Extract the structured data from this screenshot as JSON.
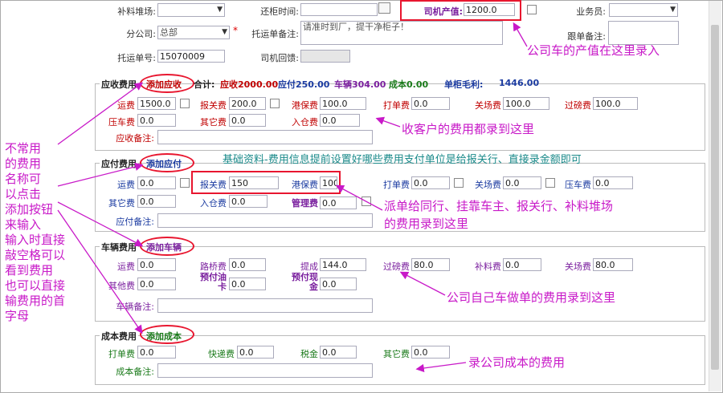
{
  "top": {
    "bu_liao_dui_chang_label": "补料堆场:",
    "huan_gui_shi_jian_label": "还柜时间:",
    "siji_chanzhi_label": "司机产值:",
    "siji_chanzhi_value": "1200.0",
    "ye_wu_yuan_label": "业务员:",
    "fen_gong_si_label": "分公司:",
    "fen_gong_si_value": "总部",
    "required_mark": "*",
    "tuo_yun_dan_bei_zhu_label": "托运单备注:",
    "tuo_yun_dan_bei_zhu_value": "请准时到厂，提干净柜子！",
    "gen_dan_bei_zhu_label": "跟单备注:",
    "tuo_yun_dan_hao_label": "托运单号:",
    "tuo_yun_dan_hao_value": "15070009",
    "siji_hui_kui_label": "司机回馈:"
  },
  "receivable": {
    "title": "应收费用",
    "add_btn": "添加应收",
    "heji": "合计:",
    "yingshou": "应收2000.00",
    "yingfu": "应付250.00",
    "cheliang": "车辆304.00",
    "chengben": "成本0.00",
    "maoli_label": "单柜毛利:",
    "maoli_value": "1446.00",
    "fields": {
      "yunfei_label": "运费",
      "yunfei": "1500.0",
      "baoguan_label": "报关费",
      "baoguan": "200.0",
      "gangbao_label": "港保费",
      "gangbao": "100.0",
      "dadan_label": "打单费",
      "dadan": "0.0",
      "guanchang_label": "关场费",
      "guanchang": "100.0",
      "guoqiao_label": "过磅费",
      "guoqiao": "100.0",
      "yache_label": "压车费",
      "yache": "0.0",
      "qita_label": "其它费",
      "qita": "0.0",
      "rucang_label": "入仓费",
      "rucang": "0.0",
      "beizhu_label": "应收备注:"
    }
  },
  "payable": {
    "title": "应付费用",
    "add_btn": "添加应付",
    "fields": {
      "yunfei_label": "运费",
      "yunfei": "0.0",
      "baoguan_label": "报关费",
      "baoguan": "150",
      "gangbao_label": "港保费",
      "gangbao": "100",
      "dadan_label": "打单费",
      "dadan": "0.0",
      "guanchang_label": "关场费",
      "guanchang": "0.0",
      "yache_label": "压车费",
      "yache": "0.0",
      "qita_label": "其它费",
      "qita": "0.0",
      "rucang_label": "入仓费",
      "rucang": "0.0",
      "guanli_label": "管理费",
      "guanli": "0.0",
      "beizhu_label": "应付备注:"
    }
  },
  "vehicle": {
    "title": "车辆费用",
    "add_btn": "添加车辆",
    "fields": {
      "yunfei_label": "运费",
      "yunfei": "0.0",
      "luqiao_label": "路桥费",
      "luqiao": "0.0",
      "ticheng_label": "提成",
      "ticheng": "144.0",
      "guobang_label": "过磅费",
      "guobang": "80.0",
      "buliao_label": "补料费",
      "buliao": "0.0",
      "guanchang_label": "关场费",
      "guanchang": "80.0",
      "qita_label": "其他费",
      "qita": "0.0",
      "yufu_youka_label": "预付油卡",
      "yufu_youka": "0.0",
      "yufu_xianjin_label": "预付现金",
      "yufu_xianjin": "0.0",
      "beizhu_label": "车辆备注:"
    }
  },
  "cost": {
    "title": "成本费用",
    "add_btn": "添加成本",
    "fields": {
      "dadan_label": "打单费",
      "dadan": "0.0",
      "kuaidi_label": "快递费",
      "kuaidi": "0.0",
      "shuijin_label": "税金",
      "shuijin": "0.0",
      "qita_label": "其它费",
      "qita": "0.0",
      "beizhu_label": "成本备注:"
    }
  },
  "annotations": {
    "a1": "公司车的产值在这里录入",
    "a2": "收客户的费用都录到这里",
    "a3": "基础资料-费用信息提前设置好哪些费用支付单位是给报关行、直接录金额即可",
    "a4": "派单给同行、挂靠车主、报关行、补料堆场",
    "a4b": "的费用录到这里",
    "a5": "公司自己车做单的费用录到这里",
    "a6": "录公司成本的费用",
    "side": "不常用\n的费用\n名称可\n以点击\n添加按钮\n来输入\n输入时直接\n敲空格可以\n看到费用\n也可以直接\n输费用的首\n字母"
  },
  "colors": {
    "annotation": "#c819c8",
    "highlight": "#e8162f",
    "teal_note": "#1a8a8a",
    "gray_field": "#e6e6e6"
  }
}
